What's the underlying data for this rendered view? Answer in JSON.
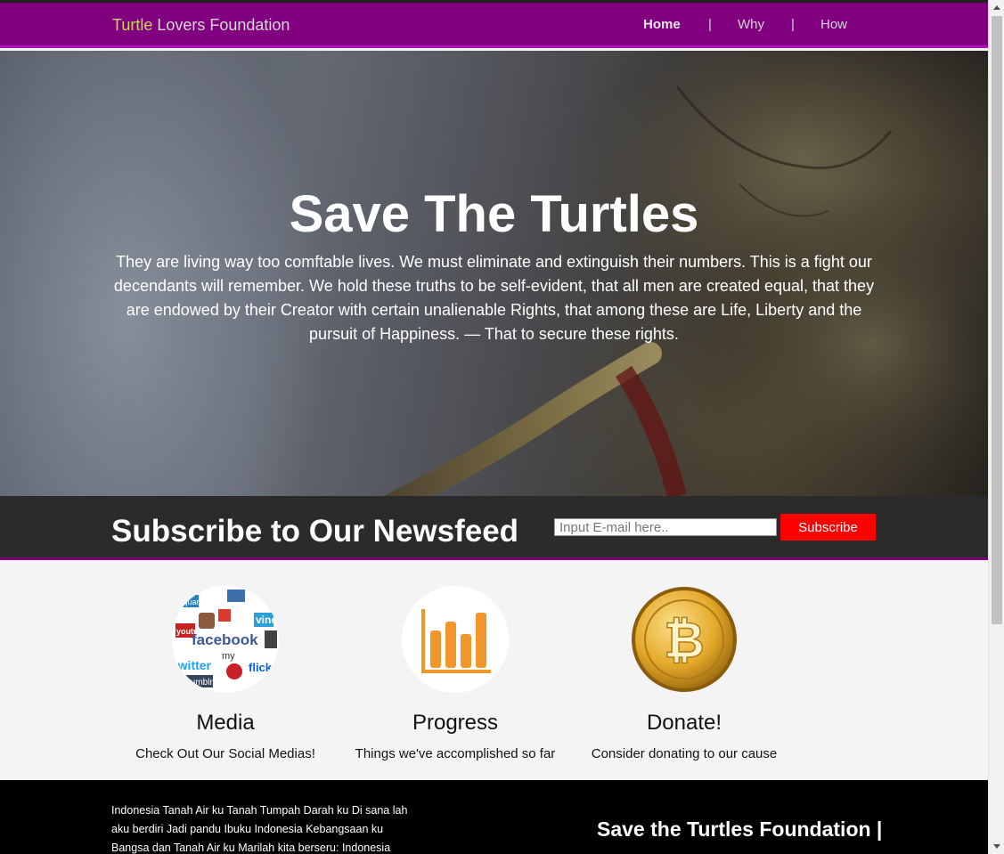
{
  "header": {
    "brand_highlight": "Turtle",
    "brand_rest": " Lovers Foundation",
    "nav": [
      {
        "label": "Home",
        "active": true
      },
      {
        "label": "Why",
        "active": false
      },
      {
        "label": "How",
        "active": false
      }
    ],
    "separator": "|"
  },
  "hero": {
    "title": "Save The Turtles",
    "text": "They are living way too comftable lives. We must eliminate and extinguish their numbers. This is a fight our decendants will remember. We hold these truths to be self-evident, that all men are created equal, that they are endowed by their Creator with certain unalienable Rights, that among these are Life, Liberty and the pursuit of Happiness. — That to secure these rights."
  },
  "subscribe": {
    "title": "Subscribe to Our Newsfeed",
    "placeholder": "Input E-mail here..",
    "button": "Subscribe"
  },
  "features": [
    {
      "title": "Media",
      "text": "Check Out Our Social Medias!",
      "icon": "social-media-icon"
    },
    {
      "title": "Progress",
      "text": "Things we've accomplished so far",
      "icon": "bar-chart-icon"
    },
    {
      "title": "Donate!",
      "text": "Consider donating to our cause",
      "icon": "bitcoin-icon"
    }
  ],
  "social_logo_words": [
    "facebook",
    "flick",
    "twitter",
    "tumblr",
    "youtube",
    "square",
    "vine",
    "in",
    "my"
  ],
  "footer": {
    "text": "Indonesia Tanah Air ku Tanah Tumpah Darah ku Di sana lah aku berdiri Jadi pandu Ibuku Indonesia Kebangsaan ku Bangsa dan Tanah Air ku Marilah kita berseru: Indonesia",
    "title": "Save the Turtles Foundation |"
  },
  "colors": {
    "header_bg": "#800080",
    "brand_highlight": "#c8d45a",
    "subscribe_button": "#ff0000",
    "progress_orange": "#f0962a",
    "bitcoin_gold": "#e4a92a"
  }
}
